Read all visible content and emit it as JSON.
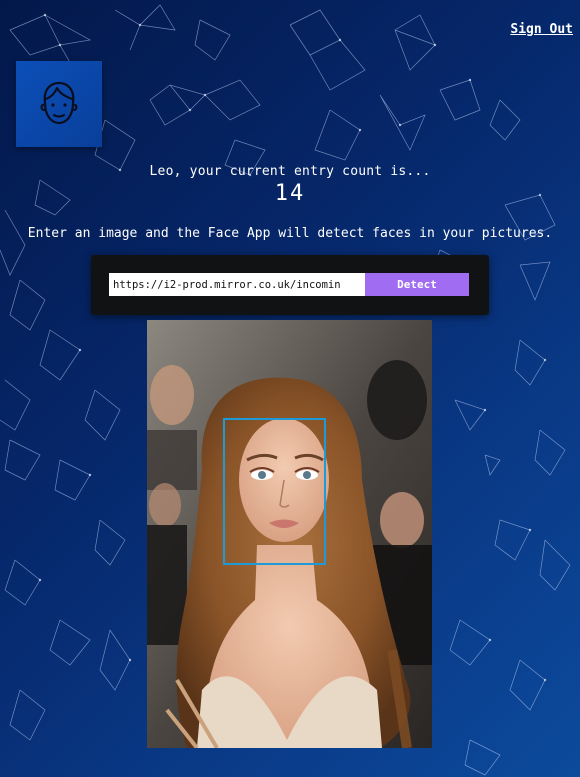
{
  "header": {
    "sign_out_label": "Sign Out"
  },
  "logo": {
    "icon": "user-face-icon",
    "background_color": "#0b4fb8"
  },
  "rank": {
    "message": "Leo, your current entry count is...",
    "count": "14"
  },
  "description": "Enter an image and the Face App will detect faces in your pictures.",
  "image_form": {
    "url_value": "https://i2-prod.mirror.co.uk/incomin",
    "detect_label": "Detect",
    "button_color": "#9f6cf2"
  },
  "result": {
    "face_box_color": "#1e9ad8"
  }
}
